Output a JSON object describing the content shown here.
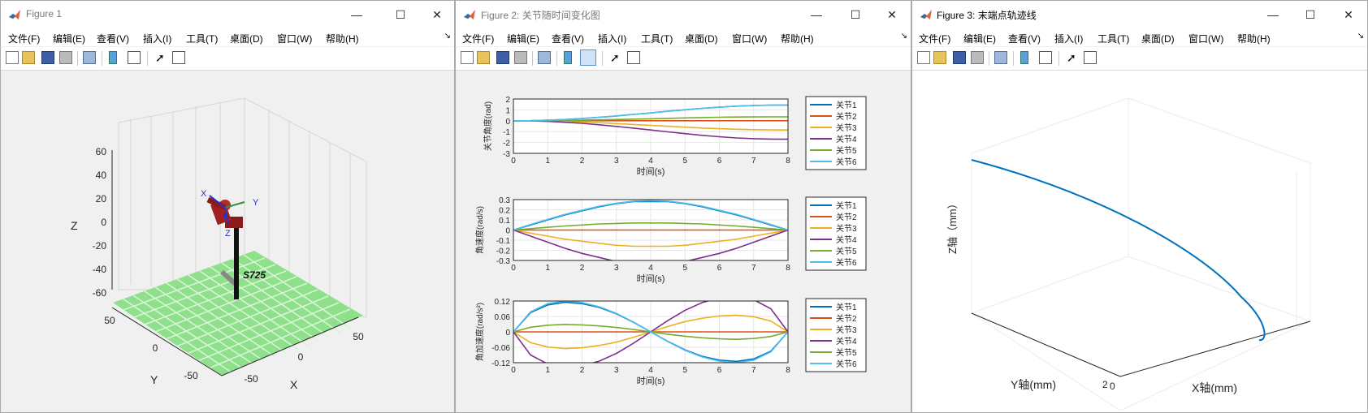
{
  "windows": [
    {
      "title": "Figure 1",
      "controls": {
        "minimize": "—",
        "maximize": "☐",
        "close": "✕"
      },
      "menu": [
        "文件(F)",
        "编辑(E)",
        "查看(V)",
        "插入(I)",
        "工具(T)",
        "桌面(D)",
        "窗口(W)",
        "帮助(H)"
      ],
      "axes3d": {
        "z_label": "Z",
        "y_label": "Y",
        "x_label": "X",
        "z_ticks": [
          "60",
          "40",
          "20",
          "0",
          "-20",
          "-40",
          "-60"
        ],
        "y_ticks": [
          "50",
          "0",
          "-50"
        ],
        "x_ticks": [
          "-50",
          "0",
          "50"
        ],
        "robot_label": "S725",
        "frame_labels": {
          "x": "X",
          "y": "Y",
          "z": "Z"
        }
      }
    },
    {
      "title": "Figure 2: 关节随时间变化图",
      "controls": {
        "minimize": "—",
        "maximize": "☐",
        "close": "✕"
      },
      "menu": [
        "文件(F)",
        "编辑(E)",
        "查看(V)",
        "插入(I)",
        "工具(T)",
        "桌面(D)",
        "窗口(W)",
        "帮助(H)"
      ]
    },
    {
      "title": "Figure 3: 末端点轨迹线",
      "controls": {
        "minimize": "—",
        "maximize": "☐",
        "close": "✕"
      },
      "menu": [
        "文件(F)",
        "编辑(E)",
        "查看(V)",
        "插入(I)",
        "工具(T)",
        "桌面(D)",
        "窗口(W)",
        "帮助(H)"
      ],
      "z_label": "Z轴（mm）",
      "y_label": "Y轴(mm)",
      "x_label": "X轴(mm)",
      "ticks": [
        "2",
        "0"
      ]
    }
  ],
  "colors": {
    "joint1": "#0072bd",
    "joint2": "#d95319",
    "joint3": "#edb120",
    "joint4": "#7e2f8e",
    "joint5": "#77ac30",
    "joint6": "#4dbeee"
  },
  "chart_data": [
    {
      "type": "line",
      "x": [
        0,
        0.5,
        1,
        1.5,
        2,
        2.5,
        3,
        3.5,
        4,
        4.5,
        5,
        5.5,
        6,
        6.5,
        7,
        7.5,
        8
      ],
      "xlim": [
        0,
        8
      ],
      "ylim": [
        -3,
        2
      ],
      "xticks": [
        "0",
        "1",
        "2",
        "3",
        "4",
        "5",
        "6",
        "7",
        "8"
      ],
      "yticks": [
        "2",
        "1",
        "0",
        "-1",
        "-2",
        "-3"
      ],
      "xlabel": "时间(s)",
      "ylabel": "关节角度(rad)",
      "grid": true,
      "legend": "right",
      "series": [
        {
          "name": "关节1",
          "values": [
            0,
            0.01,
            0.05,
            0.11,
            0.2,
            0.31,
            0.44,
            0.58,
            0.72,
            0.87,
            1.01,
            1.14,
            1.25,
            1.34,
            1.4,
            1.43,
            1.44
          ]
        },
        {
          "name": "关节2",
          "values": [
            0,
            0,
            0,
            0,
            0,
            0,
            0,
            0,
            0,
            0,
            0,
            0,
            0,
            0,
            0,
            0,
            0
          ]
        },
        {
          "name": "关节3",
          "values": [
            0,
            -0.01,
            -0.03,
            -0.07,
            -0.12,
            -0.18,
            -0.26,
            -0.34,
            -0.43,
            -0.51,
            -0.59,
            -0.67,
            -0.73,
            -0.78,
            -0.82,
            -0.84,
            -0.85
          ]
        },
        {
          "name": "关节4",
          "values": [
            0,
            -0.01,
            -0.06,
            -0.14,
            -0.24,
            -0.37,
            -0.52,
            -0.68,
            -0.85,
            -1.02,
            -1.19,
            -1.34,
            -1.47,
            -1.58,
            -1.65,
            -1.69,
            -1.7
          ]
        },
        {
          "name": "关节5",
          "values": [
            0,
            0.003,
            0.01,
            0.03,
            0.05,
            0.08,
            0.11,
            0.15,
            0.18,
            0.22,
            0.26,
            0.29,
            0.32,
            0.34,
            0.35,
            0.36,
            0.36
          ]
        },
        {
          "name": "关节6",
          "values": [
            0,
            0.01,
            0.05,
            0.11,
            0.2,
            0.31,
            0.44,
            0.58,
            0.72,
            0.87,
            1.01,
            1.14,
            1.25,
            1.34,
            1.4,
            1.43,
            1.44
          ]
        }
      ]
    },
    {
      "type": "line",
      "x": [
        0,
        0.5,
        1,
        1.5,
        2,
        2.5,
        3,
        3.5,
        4,
        4.5,
        5,
        5.5,
        6,
        6.5,
        7,
        7.5,
        8
      ],
      "xlim": [
        0,
        8
      ],
      "ylim": [
        -0.3,
        0.3
      ],
      "xticks": [
        "0",
        "1",
        "2",
        "3",
        "4",
        "5",
        "6",
        "7",
        "8"
      ],
      "yticks": [
        "0.3",
        "0.2",
        "0.1",
        "0",
        "-0.1",
        "-0.2",
        "-0.3"
      ],
      "xlabel": "时间(s)",
      "ylabel": "角速度(rad/s)",
      "grid": true,
      "legend": "right",
      "series": [
        {
          "name": "关节1",
          "values": [
            0,
            0.05,
            0.1,
            0.15,
            0.19,
            0.23,
            0.26,
            0.28,
            0.28,
            0.28,
            0.26,
            0.23,
            0.19,
            0.15,
            0.1,
            0.05,
            0
          ]
        },
        {
          "name": "关节2",
          "values": [
            0,
            0,
            0,
            0,
            0,
            0,
            0,
            0,
            0,
            0,
            0,
            0,
            0,
            0,
            0,
            0,
            0
          ]
        },
        {
          "name": "关节3",
          "values": [
            0,
            -0.03,
            -0.06,
            -0.09,
            -0.11,
            -0.13,
            -0.15,
            -0.16,
            -0.16,
            -0.16,
            -0.15,
            -0.13,
            -0.11,
            -0.09,
            -0.06,
            -0.03,
            0
          ]
        },
        {
          "name": "关节4",
          "values": [
            0,
            -0.06,
            -0.12,
            -0.18,
            -0.23,
            -0.27,
            -0.31,
            -0.33,
            -0.33,
            -0.33,
            -0.31,
            -0.27,
            -0.23,
            -0.18,
            -0.12,
            -0.06,
            0
          ]
        },
        {
          "name": "关节5",
          "values": [
            0,
            0.014,
            0.027,
            0.04,
            0.05,
            0.06,
            0.065,
            0.07,
            0.07,
            0.07,
            0.065,
            0.06,
            0.05,
            0.04,
            0.027,
            0.014,
            0
          ]
        },
        {
          "name": "关节6",
          "values": [
            0,
            0.055,
            0.105,
            0.155,
            0.195,
            0.235,
            0.265,
            0.285,
            0.29,
            0.285,
            0.265,
            0.235,
            0.195,
            0.155,
            0.105,
            0.055,
            0
          ]
        }
      ]
    },
    {
      "type": "line",
      "x": [
        0,
        0.5,
        1,
        1.5,
        2,
        2.5,
        3,
        3.5,
        4,
        4.5,
        5,
        5.5,
        6,
        6.5,
        7,
        7.5,
        8
      ],
      "xlim": [
        0,
        8
      ],
      "ylim": [
        -0.12,
        0.12
      ],
      "xticks": [
        "0",
        "1",
        "2",
        "3",
        "4",
        "5",
        "6",
        "7",
        "8"
      ],
      "yticks": [
        "0.12",
        "0.06",
        "0",
        "-0.06",
        "-0.12"
      ],
      "xlabel": "时间(s)",
      "ylabel": "角加速度(rad/s²)",
      "grid": true,
      "legend": "right",
      "series": [
        {
          "name": "关节1",
          "values": [
            0,
            0.075,
            0.105,
            0.115,
            0.11,
            0.095,
            0.07,
            0.037,
            0,
            -0.037,
            -0.07,
            -0.095,
            -0.11,
            -0.115,
            -0.105,
            -0.075,
            0
          ]
        },
        {
          "name": "关节2",
          "values": [
            0,
            0,
            0,
            0,
            0,
            0,
            0,
            0,
            0,
            0,
            0,
            0,
            0,
            0,
            0,
            0,
            0
          ]
        },
        {
          "name": "关节3",
          "values": [
            0,
            -0.042,
            -0.059,
            -0.065,
            -0.062,
            -0.053,
            -0.04,
            -0.021,
            0,
            0.021,
            0.04,
            0.053,
            0.062,
            0.065,
            0.059,
            0.042,
            0
          ]
        },
        {
          "name": "关节4",
          "values": [
            0,
            -0.09,
            -0.125,
            -0.14,
            -0.132,
            -0.114,
            -0.084,
            -0.044,
            0,
            0.044,
            0.084,
            0.114,
            0.132,
            0.14,
            0.125,
            0.09,
            0
          ]
        },
        {
          "name": "关节5",
          "values": [
            0,
            0.018,
            0.026,
            0.029,
            0.027,
            0.023,
            0.017,
            0.009,
            0,
            -0.009,
            -0.017,
            -0.023,
            -0.027,
            -0.029,
            -0.026,
            -0.018,
            0
          ]
        },
        {
          "name": "关节6",
          "values": [
            0,
            0.078,
            0.11,
            0.12,
            0.114,
            0.098,
            0.072,
            0.038,
            0,
            -0.038,
            -0.072,
            -0.098,
            -0.114,
            -0.12,
            -0.11,
            -0.078,
            0
          ]
        }
      ]
    }
  ]
}
